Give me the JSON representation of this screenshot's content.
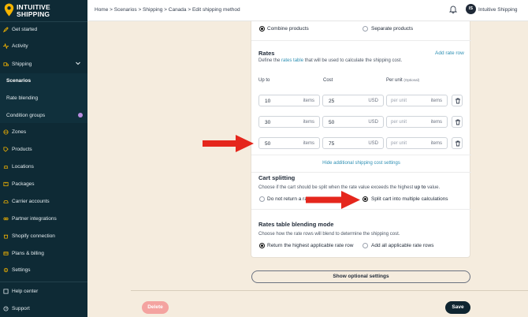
{
  "app": {
    "brand_line1": "INTUITIVE",
    "brand_line2": "SHIPPING"
  },
  "sidebar": {
    "items": [
      {
        "label": "Get started",
        "icon": "rocket-icon"
      },
      {
        "label": "Activity",
        "icon": "activity-icon"
      },
      {
        "label": "Shipping",
        "icon": "shipping-icon"
      },
      {
        "label": "Scenarios"
      },
      {
        "label": "Rate blending"
      },
      {
        "label": "Condition groups"
      },
      {
        "label": "Zones",
        "icon": "zones-icon"
      },
      {
        "label": "Products",
        "icon": "tag-icon"
      },
      {
        "label": "Locations",
        "icon": "location-icon"
      },
      {
        "label": "Packages",
        "icon": "package-icon"
      },
      {
        "label": "Carrier accounts",
        "icon": "carrier-icon"
      },
      {
        "label": "Partner integrations",
        "icon": "integration-icon"
      },
      {
        "label": "Shopify connection",
        "icon": "shopify-icon"
      },
      {
        "label": "Plans & billing",
        "icon": "billing-icon"
      },
      {
        "label": "Settings",
        "icon": "gear-icon"
      },
      {
        "label": "Help center",
        "icon": "help-icon"
      },
      {
        "label": "Support",
        "icon": "support-icon"
      }
    ]
  },
  "topbar": {
    "breadcrumb": "Home > Scenarios > Shipping > Canada > Edit shipping method",
    "avatar_initials": "IS",
    "user_name": "Intuitive Shipping"
  },
  "card": {
    "combine_label": "Combine products",
    "separate_label": "Separate products",
    "rates_title": "Rates",
    "rates_desc_pre": "Define the ",
    "rates_desc_link": "rates table",
    "rates_desc_post": " that will be used to calculate the shipping cost.",
    "add_rate_row": "Add rate row",
    "col_up_to": "Up to",
    "col_cost": "Cost",
    "col_per_unit": "Per unit",
    "col_optional": "(Optional)",
    "rows": [
      {
        "up_to": "10",
        "up_to_unit": "items",
        "cost": "25",
        "currency": "USD",
        "per_unit_placeholder": "per unit",
        "per_unit_unit": "items"
      },
      {
        "up_to": "30",
        "up_to_unit": "items",
        "cost": "50",
        "currency": "USD",
        "per_unit_placeholder": "per unit",
        "per_unit_unit": "items"
      },
      {
        "up_to": "50",
        "up_to_unit": "items",
        "cost": "75",
        "currency": "USD",
        "per_unit_placeholder": "per unit",
        "per_unit_unit": "items"
      }
    ],
    "hide_additional": "Hide additional shipping cost settings",
    "cart_split_title": "Cart splitting",
    "cart_split_desc_pre": "Choose if the cart should be split when the rate value exceeds the highest ",
    "cart_split_desc_bold": "up to",
    "cart_split_desc_post": " value.",
    "no_return_label": "Do not return a ra",
    "split_label": "Split cart into multiple calculations",
    "blend_title": "Rates table blending mode",
    "blend_desc": "Choose how the rate rows will blend to determine the shipping cost.",
    "return_highest_label": "Return the highest applicable rate row",
    "add_all_label": "Add all applicable rate rows"
  },
  "actions": {
    "show_optional": "Show optional settings",
    "delete": "Delete",
    "save": "Save"
  },
  "colors": {
    "sidebar_bg": "#0e2a35",
    "page_bg": "#f5ecde",
    "link": "#2d8fb3",
    "arrow": "#e5261c",
    "delete_bg": "#f4a3a0",
    "save_bg": "#0f2530"
  }
}
